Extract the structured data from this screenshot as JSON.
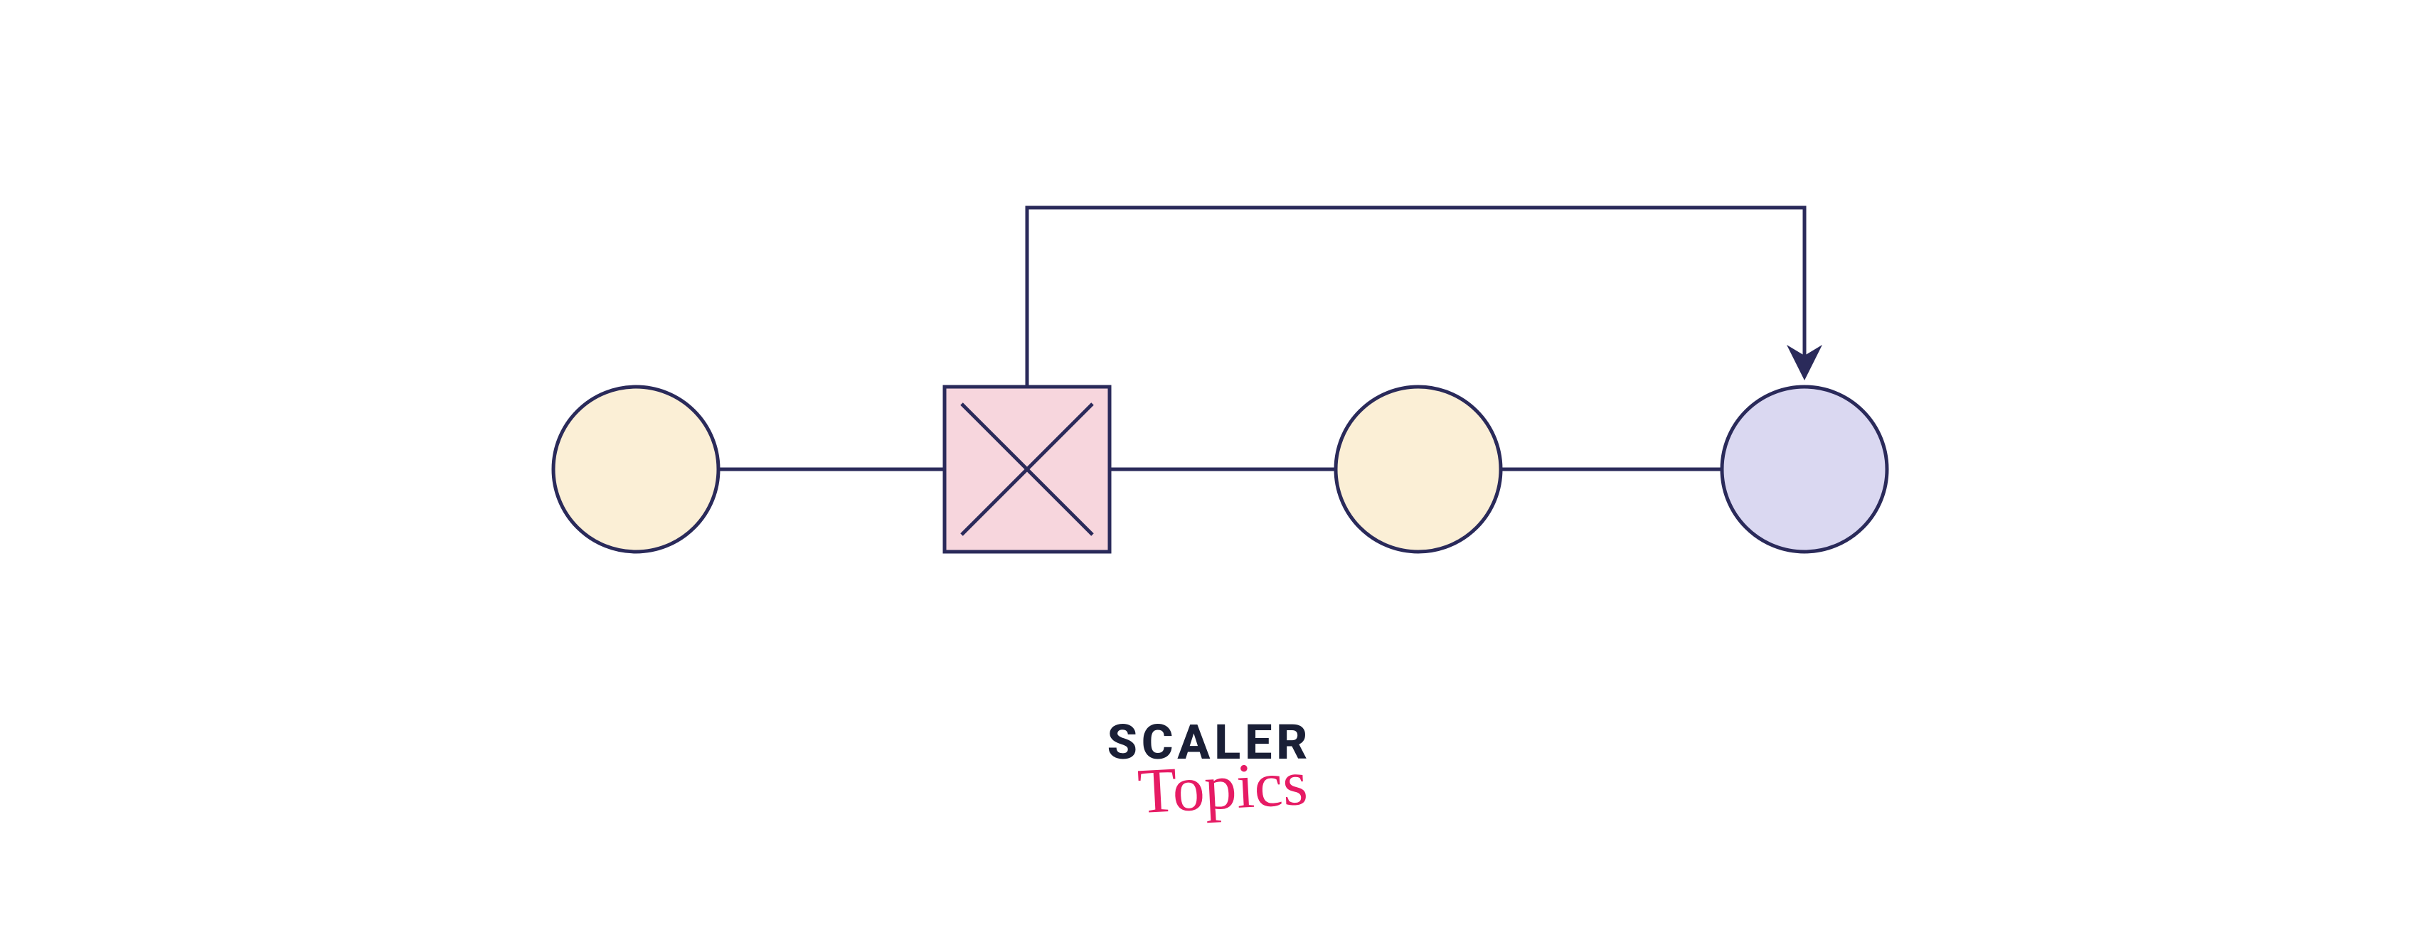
{
  "diagram": {
    "description": "Linked list node deletion diagram with feedback arrow",
    "nodes": [
      {
        "id": "node-1",
        "type": "circle",
        "fill": "cream"
      },
      {
        "id": "node-2",
        "type": "deleted-square",
        "fill": "pink"
      },
      {
        "id": "node-3",
        "type": "circle",
        "fill": "cream"
      },
      {
        "id": "node-4",
        "type": "circle",
        "fill": "lavender"
      }
    ],
    "colors": {
      "stroke": "#2a2a5a",
      "cream": "#fbefd6",
      "pink": "#f7d6dd",
      "lavender": "#dad8f1"
    }
  },
  "branding": {
    "line1": "SCALER",
    "line2": "Topics"
  }
}
